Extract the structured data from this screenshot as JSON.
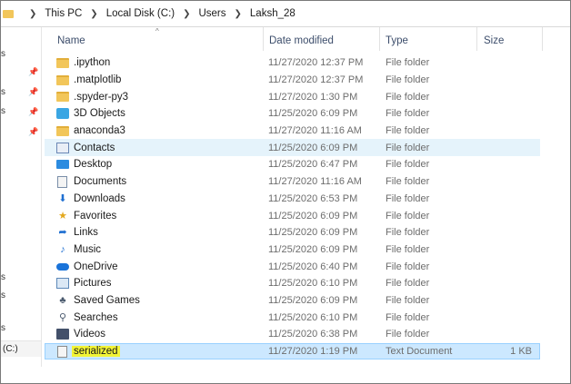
{
  "breadcrumb": [
    "This PC",
    "Local Disk (C:)",
    "Users",
    "Laksh_28"
  ],
  "nav": {
    "fragments": [
      "s",
      "s",
      "s",
      "s",
      "s",
      "s"
    ],
    "drive_label": "(C:)"
  },
  "columns": {
    "name": "Name",
    "date": "Date modified",
    "type": "Type",
    "size": "Size"
  },
  "rows": [
    {
      "name": ".ipython",
      "date": "11/27/2020 12:37 PM",
      "type": "File folder",
      "size": "",
      "icon": "folder-icon"
    },
    {
      "name": ".matplotlib",
      "date": "11/27/2020 12:37 PM",
      "type": "File folder",
      "size": "",
      "icon": "folder-icon"
    },
    {
      "name": ".spyder-py3",
      "date": "11/27/2020 1:30 PM",
      "type": "File folder",
      "size": "",
      "icon": "folder-icon"
    },
    {
      "name": "3D Objects",
      "date": "11/25/2020 6:09 PM",
      "type": "File folder",
      "size": "",
      "icon": "cube-icon"
    },
    {
      "name": "anaconda3",
      "date": "11/27/2020 11:16 AM",
      "type": "File folder",
      "size": "",
      "icon": "folder-icon"
    },
    {
      "name": "Contacts",
      "date": "11/25/2020 6:09 PM",
      "type": "File folder",
      "size": "",
      "icon": "contacts-icon"
    },
    {
      "name": "Desktop",
      "date": "11/25/2020 6:47 PM",
      "type": "File folder",
      "size": "",
      "icon": "desktop-icon"
    },
    {
      "name": "Documents",
      "date": "11/27/2020 11:16 AM",
      "type": "File folder",
      "size": "",
      "icon": "document-icon"
    },
    {
      "name": "Downloads",
      "date": "11/25/2020 6:53 PM",
      "type": "File folder",
      "size": "",
      "icon": "download-arrow-icon"
    },
    {
      "name": "Favorites",
      "date": "11/25/2020 6:09 PM",
      "type": "File folder",
      "size": "",
      "icon": "star-icon"
    },
    {
      "name": "Links",
      "date": "11/25/2020 6:09 PM",
      "type": "File folder",
      "size": "",
      "icon": "link-arrow-icon"
    },
    {
      "name": "Music",
      "date": "11/25/2020 6:09 PM",
      "type": "File folder",
      "size": "",
      "icon": "music-note-icon"
    },
    {
      "name": "OneDrive",
      "date": "11/25/2020 6:40 PM",
      "type": "File folder",
      "size": "",
      "icon": "cloud-icon"
    },
    {
      "name": "Pictures",
      "date": "11/25/2020 6:10 PM",
      "type": "File folder",
      "size": "",
      "icon": "pictures-icon"
    },
    {
      "name": "Saved Games",
      "date": "11/25/2020 6:09 PM",
      "type": "File folder",
      "size": "",
      "icon": "game-controller-icon"
    },
    {
      "name": "Searches",
      "date": "11/25/2020 6:10 PM",
      "type": "File folder",
      "size": "",
      "icon": "magnifier-icon"
    },
    {
      "name": "Videos",
      "date": "11/25/2020 6:38 PM",
      "type": "File folder",
      "size": "",
      "icon": "film-icon"
    },
    {
      "name": "serialized",
      "date": "11/27/2020 1:19 PM",
      "type": "Text Document",
      "size": "1 KB",
      "icon": "text-file-icon"
    }
  ],
  "colors": {
    "hover_row": "#e5f3fb",
    "selected_row": "#cce8ff",
    "selected_border": "#99d1ff",
    "highlight": "#f2f436",
    "folder": "#f2c65a"
  }
}
